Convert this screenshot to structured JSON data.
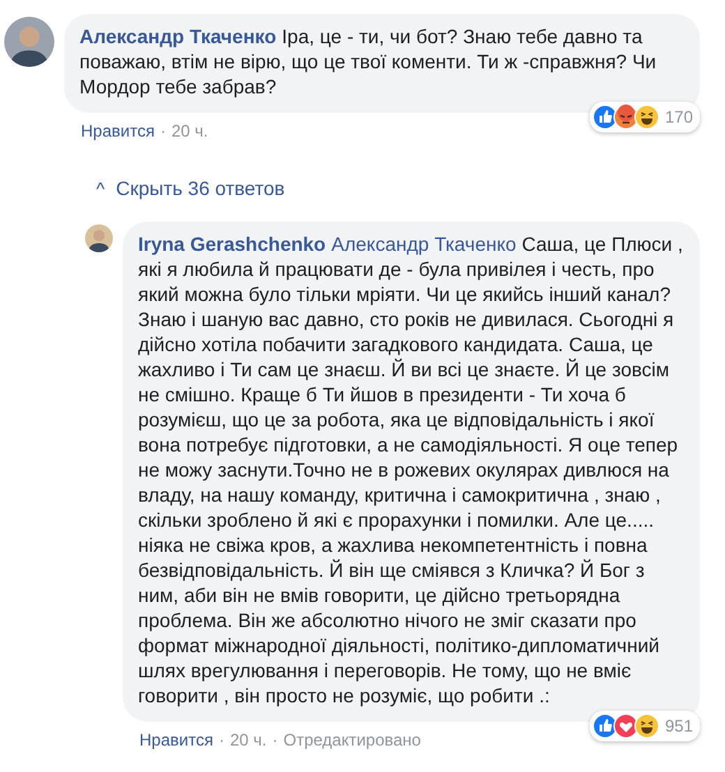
{
  "comment": {
    "author": "Александр Ткаченко",
    "text": "Іра, це - ти, чи бот? Знаю тебе давно та поважаю, втім не вірю, що це твої коменти. Ти ж -справжня? Чи Мордор тебе забрав?",
    "reactions": [
      {
        "kind": "like"
      },
      {
        "kind": "angry"
      },
      {
        "kind": "haha"
      }
    ],
    "reaction_count": "170",
    "actions": [
      {
        "kind": "link",
        "text": "Нравится"
      },
      {
        "kind": "separator",
        "text": "·"
      },
      {
        "kind": "time",
        "text": "20 ч."
      }
    ]
  },
  "toggle_replies": {
    "icon": "^",
    "label": "Скрыть 36 ответов"
  },
  "reply": {
    "author": "Iryna Gerashchenko",
    "mention": "Александр Ткаченко",
    "text": "Саша, це Плюси , які я любила й працювати де - була привілея і честь, про який можна було тільки мріяти. Чи це якийсь інший канал? Знаю і шаную вас давно, сто років не дивилася. Сьогодні я дійсно хотіла побачити загадкового кандидата. Саша, це жахливо і Ти сам це знаєш. Й ви всі це знаєте. Й це зовсім не смішно. Краще б Ти йшов в президенти - Ти хоча б розумієш, що це за робота, яка це відповідальність і якої вона потребує підготовки, а не самодіяльності. Я оце тепер не можу заснути.Точно не в рожевих окулярах дивлюся на владу, на нашу команду, критична і самокритична , знаю , скільки зроблено й які є прорахунки і помилки. Але це..... ніяка не свіжа кров, а жахлива некомпетентність і повна безвідповідальність. Й він ще сміявся з Кличка? Й Бог з ним, аби він не вмів говорити, це дійсно третьорядна проблема. Він же абсолютно нічого не зміг сказати про формат міжнародної діяльності, політико-дипломатичний шлях врегулювання і переговорів. Не тому, що не вміє говорити , він просто не розуміє, що робити .:",
    "reactions": [
      {
        "kind": "like"
      },
      {
        "kind": "love"
      },
      {
        "kind": "haha"
      }
    ],
    "reaction_count": "951",
    "actions": [
      {
        "kind": "link",
        "text": "Нравится"
      },
      {
        "kind": "separator",
        "text": "·"
      },
      {
        "kind": "time",
        "text": "20 ч."
      },
      {
        "kind": "separator",
        "text": "·"
      },
      {
        "kind": "note",
        "text": "Отредактировано"
      }
    ]
  }
}
